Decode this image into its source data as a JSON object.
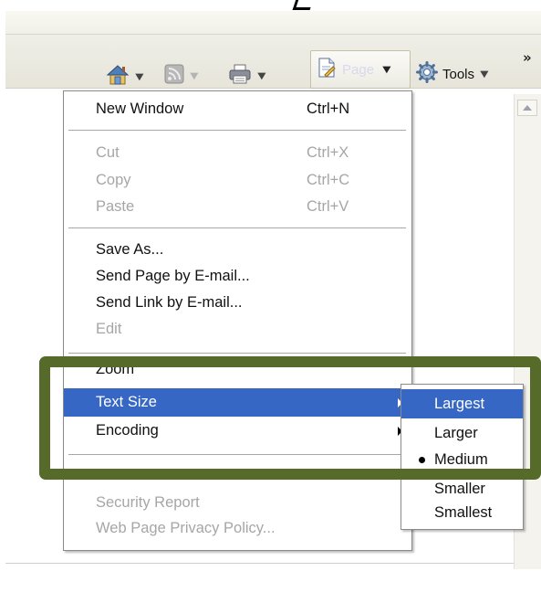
{
  "toolbar": {
    "page_label": "Page",
    "tools_label": "Tools",
    "more_label": "»",
    "icons": {
      "home": "home-icon",
      "feeds": "feeds-icon",
      "print": "printer-icon",
      "page": "page-icon",
      "tools": "gear-icon"
    }
  },
  "menu": {
    "new_window": {
      "label": "New Window",
      "shortcut": "Ctrl+N"
    },
    "cut": {
      "label": "Cut",
      "shortcut": "Ctrl+X"
    },
    "copy": {
      "label": "Copy",
      "shortcut": "Ctrl+C"
    },
    "paste": {
      "label": "Paste",
      "shortcut": "Ctrl+V"
    },
    "save_as": {
      "label": "Save As..."
    },
    "send_page": {
      "label": "Send Page by E-mail..."
    },
    "send_link": {
      "label": "Send Link by E-mail..."
    },
    "edit": {
      "label": "Edit"
    },
    "zoom": {
      "label": "Zoom"
    },
    "text_size": {
      "label": "Text Size"
    },
    "encoding": {
      "label": "Encoding"
    },
    "security_report": {
      "label": "Security Report"
    },
    "privacy_policy": {
      "label": "Web Page Privacy Policy..."
    }
  },
  "text_size_submenu": {
    "items": [
      {
        "label": "Largest"
      },
      {
        "label": "Larger"
      },
      {
        "label": "Medium"
      },
      {
        "label": "Smaller"
      },
      {
        "label": "Smallest"
      }
    ]
  },
  "colors": {
    "highlight_frame": "#566a2a",
    "selection": "#3667c5"
  }
}
